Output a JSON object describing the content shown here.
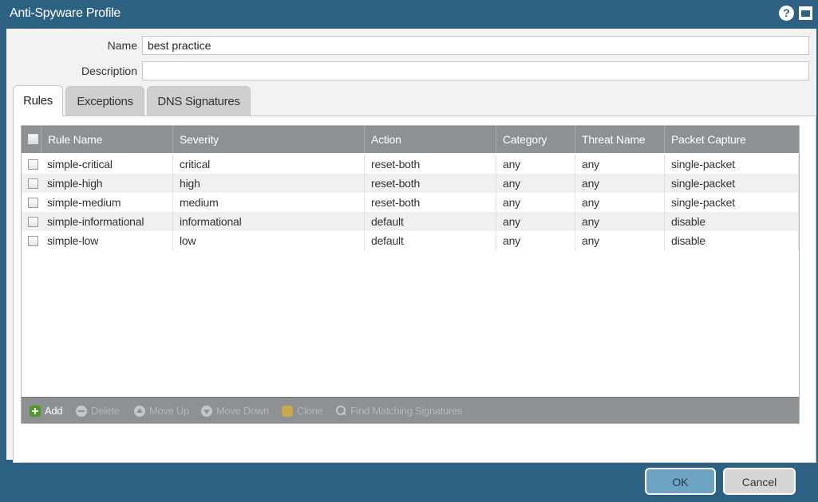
{
  "window": {
    "title": "Anti-Spyware Profile",
    "help_glyph": "?"
  },
  "form": {
    "name_label": "Name",
    "name_value": "best practice",
    "description_label": "Description",
    "description_value": ""
  },
  "tabs": [
    {
      "label": "Rules",
      "active": true
    },
    {
      "label": "Exceptions",
      "active": false
    },
    {
      "label": "DNS Signatures",
      "active": false
    }
  ],
  "table": {
    "columns": [
      "Rule Name",
      "Severity",
      "Action",
      "Category",
      "Threat Name",
      "Packet Capture"
    ],
    "rows": [
      [
        "simple-critical",
        "critical",
        "reset-both",
        "any",
        "any",
        "single-packet"
      ],
      [
        "simple-high",
        "high",
        "reset-both",
        "any",
        "any",
        "single-packet"
      ],
      [
        "simple-medium",
        "medium",
        "reset-both",
        "any",
        "any",
        "single-packet"
      ],
      [
        "simple-informational",
        "informational",
        "default",
        "any",
        "any",
        "disable"
      ],
      [
        "simple-low",
        "low",
        "default",
        "any",
        "any",
        "disable"
      ]
    ]
  },
  "toolbar": {
    "add": "Add",
    "delete": "Delete",
    "move_up": "Move Up",
    "move_down": "Move Down",
    "clone": "Clone",
    "find": "Find Matching Signatures"
  },
  "footer": {
    "ok": "OK",
    "cancel": "Cancel"
  },
  "colors": {
    "titlebar": "#2d6181",
    "grid_header": "#8d9193",
    "ok_button": "#6da3c3"
  }
}
